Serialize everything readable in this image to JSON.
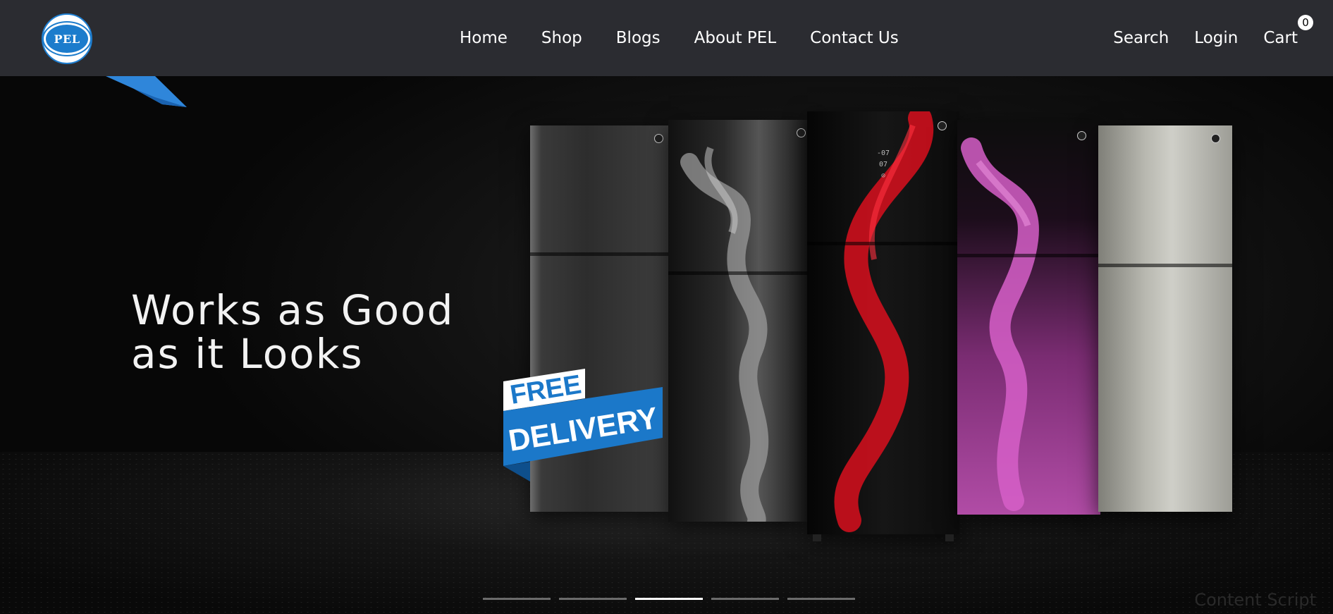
{
  "brand": {
    "logo_text": "PEL",
    "accent": "#1c7ccc"
  },
  "nav": {
    "main": [
      {
        "label": "Home"
      },
      {
        "label": "Shop"
      },
      {
        "label": "Blogs"
      },
      {
        "label": "About PEL"
      },
      {
        "label": "Contact Us"
      }
    ],
    "search_label": "Search",
    "login_label": "Login",
    "cart_label": "Cart",
    "cart_count": "0"
  },
  "hero": {
    "headline": "Works as Good\nas it Looks",
    "promo_line1": "FREE",
    "promo_line2": "DELIVERY",
    "fridge_display": [
      "-07",
      "07",
      "⊙"
    ],
    "slides_total": 5,
    "active_slide": 3
  },
  "overlay": {
    "text": "Content Script"
  }
}
